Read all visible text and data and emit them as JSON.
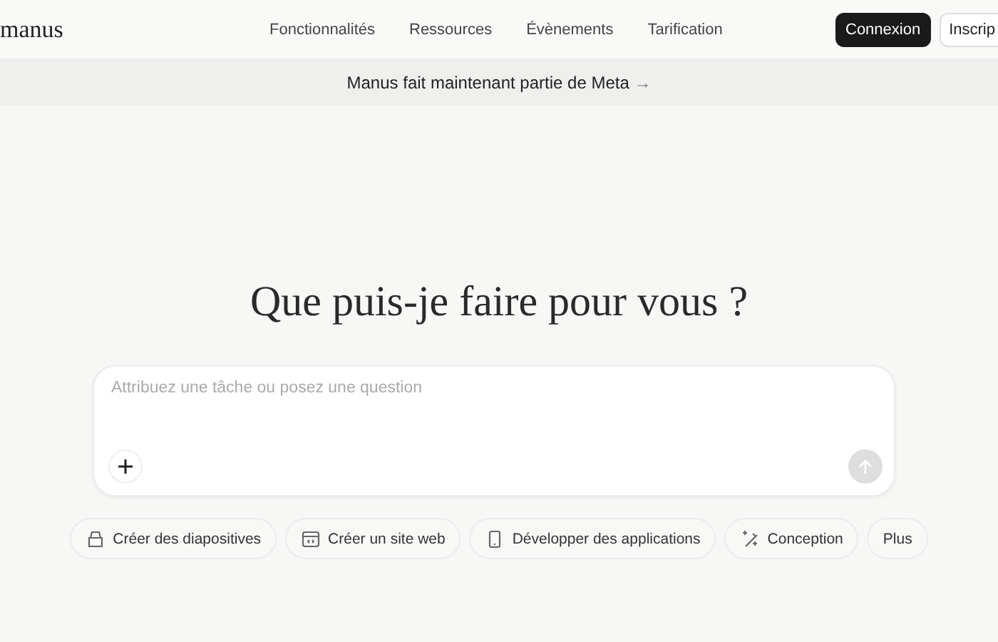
{
  "header": {
    "logo": "manus",
    "nav": [
      "Fonctionnalités",
      "Ressources",
      "Évènements",
      "Tarification"
    ],
    "login": "Connexion",
    "signup": "Inscrip"
  },
  "banner": {
    "text": "Manus fait maintenant partie de Meta",
    "arrow": "→"
  },
  "heading": "Que puis-je faire pour vous ?",
  "prompt": {
    "placeholder": "Attribuez une tâche ou posez une question"
  },
  "chips": [
    {
      "label": "Créer des diapositives",
      "kind": "slides"
    },
    {
      "label": "Créer un site web",
      "kind": "web"
    },
    {
      "label": "Développer des applications",
      "kind": "app"
    },
    {
      "label": "Conception",
      "kind": "design"
    },
    {
      "label": "Plus",
      "kind": "none"
    }
  ]
}
